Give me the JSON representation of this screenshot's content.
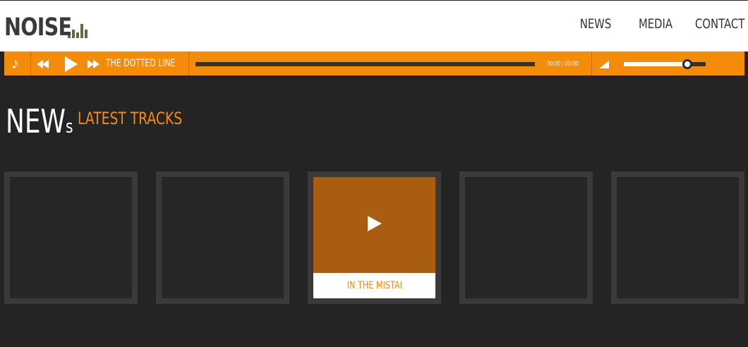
{
  "header": {
    "logo_text": "NOISE",
    "nav": {
      "news": "NEWS",
      "media": "MEDIA",
      "contact": "CONTACT"
    }
  },
  "player": {
    "track_title": "THE DOTTED LINE",
    "time": "00:00 | 00:00",
    "progress": 0,
    "volume": 0.78,
    "icons": [
      "music-note-icon",
      "rewind-icon",
      "play-icon",
      "fast-forward-icon",
      "volume-icon"
    ]
  },
  "section": {
    "title_big": "NEW",
    "title_small": "s",
    "subtitle": "LATEST TRACKS"
  },
  "tracks": [
    {
      "label": ""
    },
    {
      "label": ""
    },
    {
      "label": "IN THE MISTAI",
      "active": true
    },
    {
      "label": ""
    },
    {
      "label": ""
    }
  ],
  "colors": {
    "accent": "#f58b0a",
    "background": "#242424",
    "tile_art": "#a85d10",
    "logo_bars": "#5f6b48"
  }
}
